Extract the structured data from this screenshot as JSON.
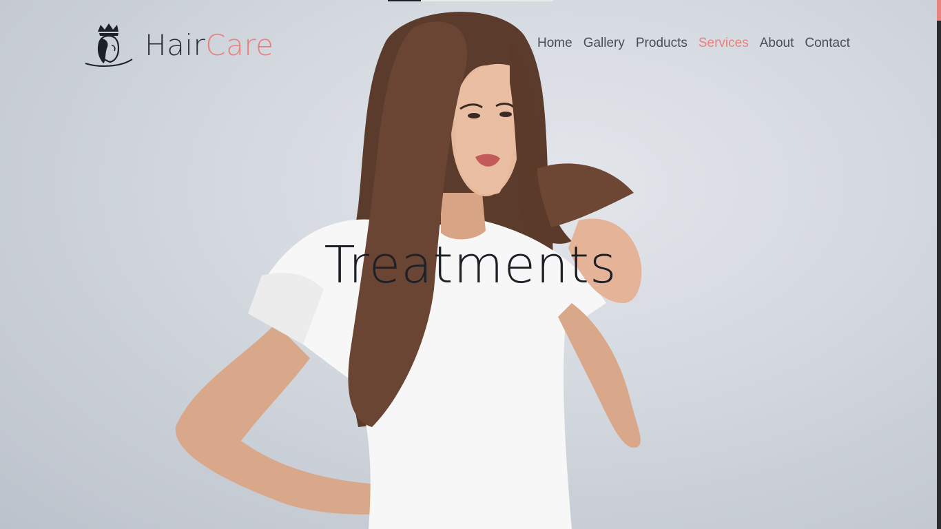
{
  "brand": {
    "name_part1": "Hair",
    "name_part2": "Care",
    "logo_icon": "crowned-woman-silhouette-icon",
    "color_dark": "#2c3036",
    "color_accent": "#ea7f7c"
  },
  "nav": {
    "items": [
      {
        "label": "Home",
        "active": false
      },
      {
        "label": "Gallery",
        "active": false
      },
      {
        "label": "Products",
        "active": false
      },
      {
        "label": "Services",
        "active": true
      },
      {
        "label": "About",
        "active": false
      },
      {
        "label": "Contact",
        "active": false
      }
    ],
    "color_default": "#4a4e55",
    "color_active": "#e97f7c"
  },
  "hero": {
    "title": "Treatments",
    "image": "woman-examining-split-hair-ends-photo"
  }
}
